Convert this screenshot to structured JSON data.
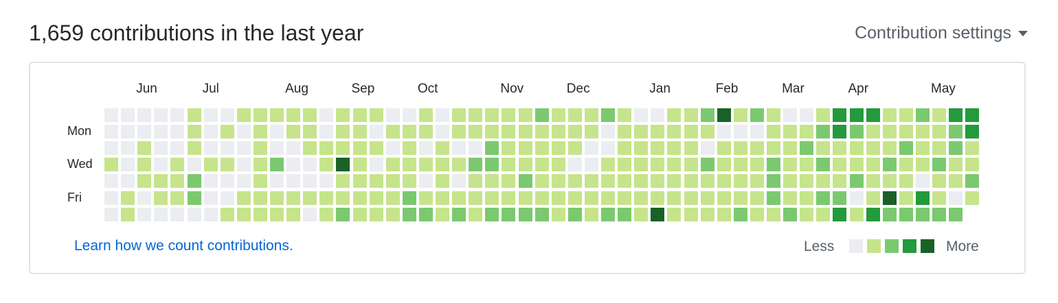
{
  "header": {
    "title": "1,659 contributions in the last year",
    "settings_label": "Contribution settings"
  },
  "months": [
    "Jun",
    "Jul",
    "Aug",
    "Sep",
    "Oct",
    "Nov",
    "Dec",
    "Jan",
    "Feb",
    "Mar",
    "Apr",
    "May"
  ],
  "month_week_index": [
    2,
    6,
    11,
    15,
    19,
    24,
    28,
    33,
    37,
    41,
    45,
    50
  ],
  "day_labels": [
    {
      "label": "Mon",
      "row": 1
    },
    {
      "label": "Wed",
      "row": 3
    },
    {
      "label": "Fri",
      "row": 5
    }
  ],
  "colors": [
    "#ebedf0",
    "#c6e48b",
    "#7bc96f",
    "#239a3b",
    "#196127"
  ],
  "weeks": 53,
  "last_week_days": 6,
  "grid": [
    "00000100111110111001011111211121001124121001333112133",
    "00000101010110110111011111111101111110001112321111123",
    "00100100010011111010100211111001111101111121111121121",
    "10101011012001410111112211110011111121112112111211211",
    "00111200010000111110101112111111111111112111121110112",
    "01011200111111111121111111111111111111112112201413101",
    "01000001111101211122121222212122141111211211313222222"
  ],
  "footer": {
    "learn_link": "Learn how we count contributions.",
    "less_label": "Less",
    "more_label": "More"
  }
}
